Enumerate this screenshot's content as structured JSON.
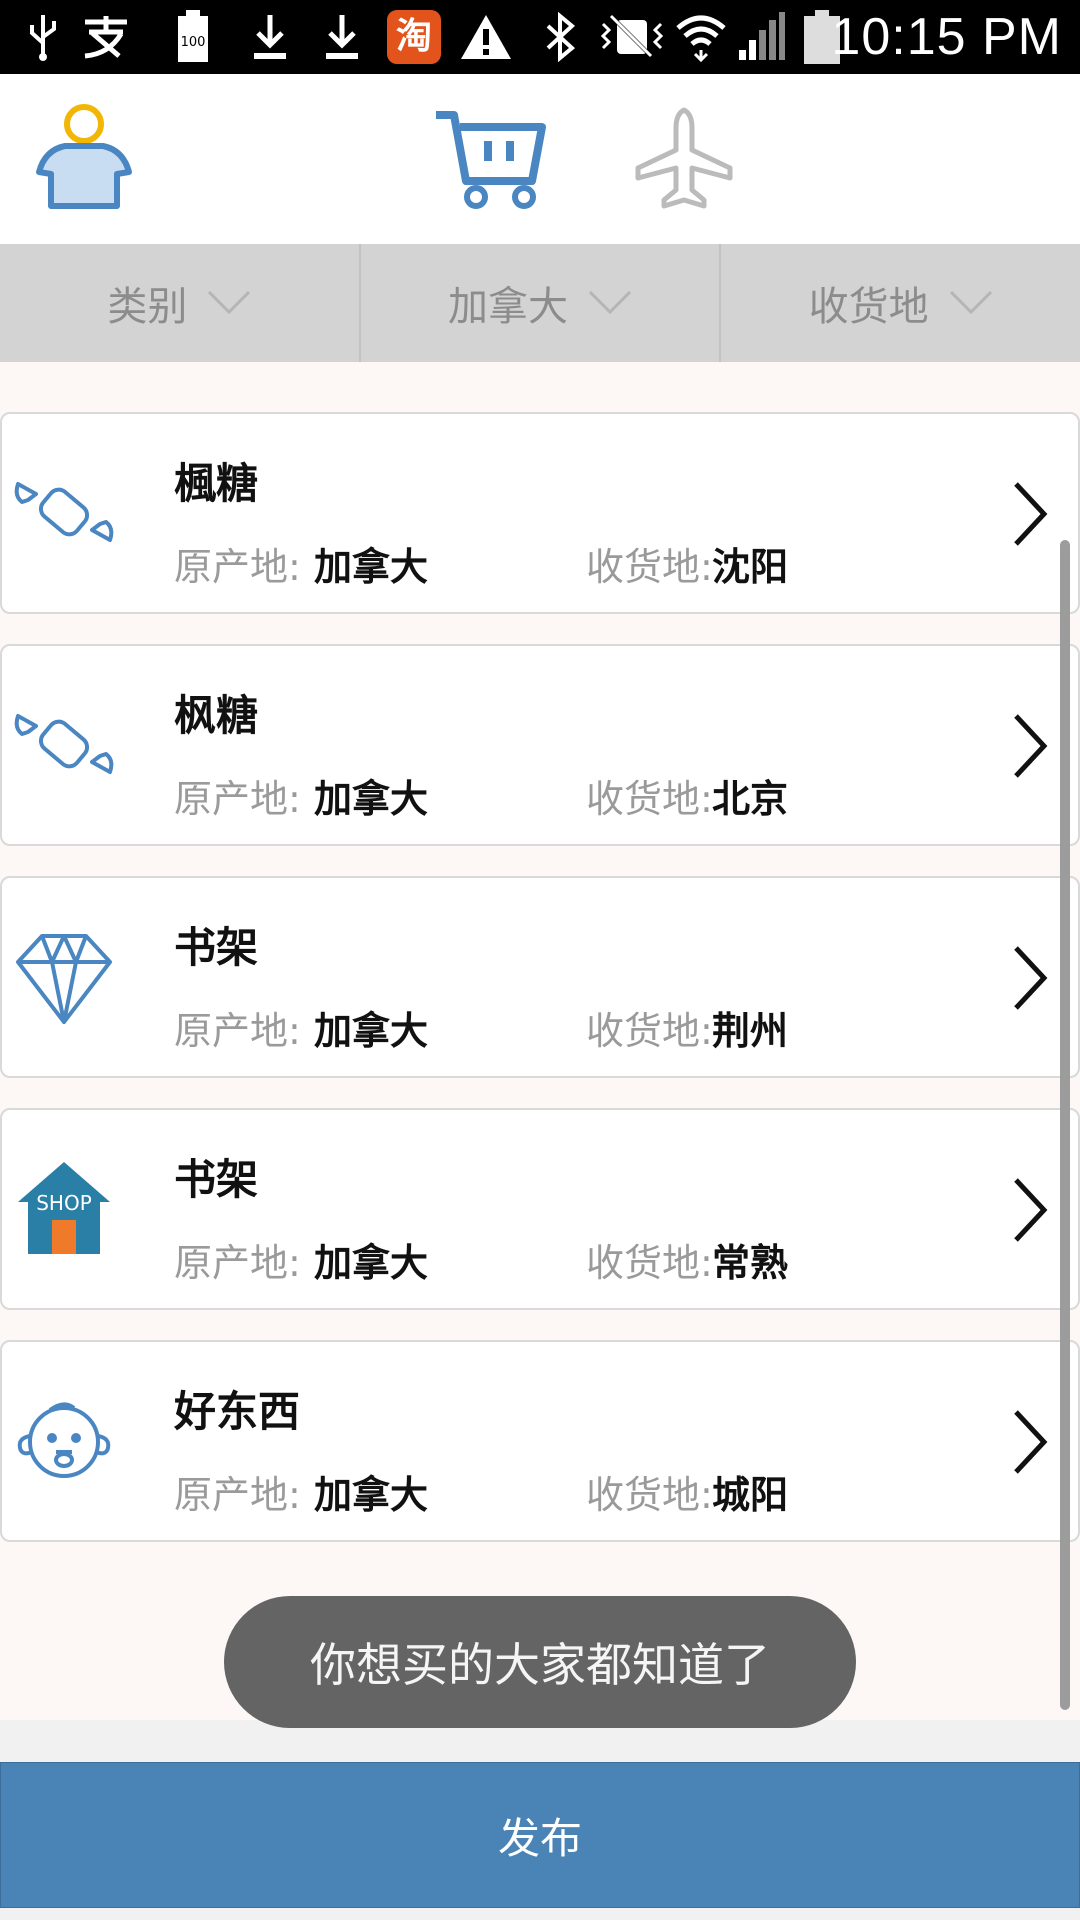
{
  "status_bar": {
    "time": "10:15 PM",
    "battery_level": "100",
    "taobao_glyph": "淘",
    "icons": [
      "usb-icon",
      "alipay-icon",
      "battery-100-icon",
      "download-icon",
      "download-icon",
      "taobao-icon",
      "warning-icon",
      "bluetooth-icon",
      "vibrate-icon",
      "wifi-icon",
      "signal-icon",
      "battery-icon"
    ]
  },
  "top_nav": {
    "items": [
      {
        "name": "profile",
        "icon": "user-icon",
        "color": "#4a86c2"
      },
      {
        "name": "shop",
        "icon": "cart-icon",
        "color": "#4a86c2"
      },
      {
        "name": "travel",
        "icon": "airplane-icon",
        "color": "#bbbbbb"
      }
    ]
  },
  "filters": [
    {
      "label": "类别",
      "icon": "chevron-down-icon"
    },
    {
      "label": "加拿大",
      "icon": "chevron-down-icon"
    },
    {
      "label": "收货地",
      "icon": "chevron-down-icon"
    }
  ],
  "list": {
    "origin_label": "原产地:",
    "dest_label": "收货地:",
    "items": [
      {
        "title": "楓糖",
        "origin": "加拿大",
        "destination": "沈阳",
        "icon": "candy-icon"
      },
      {
        "title": "枫糖",
        "origin": "加拿大",
        "destination": "北京",
        "icon": "candy-icon"
      },
      {
        "title": "书架",
        "origin": "加拿大",
        "destination": "荆州",
        "icon": "diamond-icon"
      },
      {
        "title": "书架",
        "origin": "加拿大",
        "destination": "常熟",
        "icon": "shop-icon"
      },
      {
        "title": "好东西",
        "origin": "加拿大",
        "destination": "城阳",
        "icon": "baby-icon"
      }
    ]
  },
  "toast": {
    "text": "你想买的大家都知道了"
  },
  "publish_button": {
    "label": "发布"
  },
  "colors": {
    "accent": "#4a83b6",
    "icon_blue": "#4a86c2",
    "filter_bg": "#d3d3d3",
    "toast_bg": "#646464"
  }
}
